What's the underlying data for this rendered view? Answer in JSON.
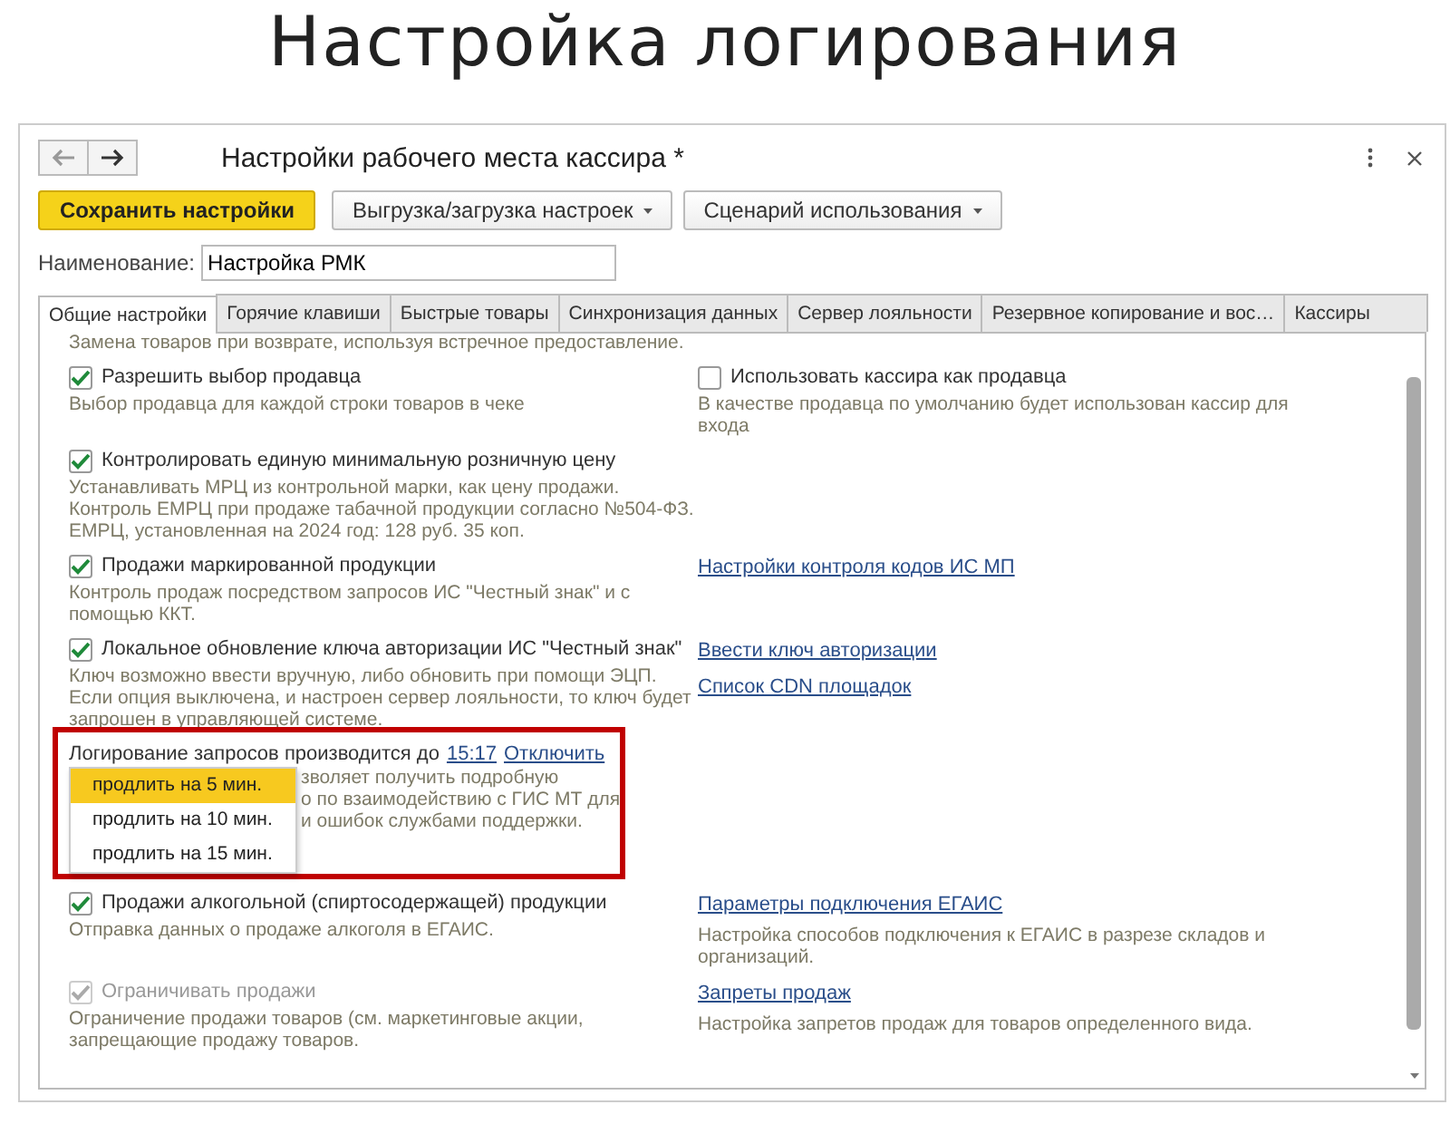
{
  "heading": "Настройка логирования",
  "window": {
    "title": "Настройки рабочего места кассира *"
  },
  "toolbar": {
    "buttons": [
      {
        "label": "Сохранить настройки",
        "kind": "primary"
      },
      {
        "label": "Выгрузка/загрузка настроек",
        "kind": "dropdown"
      },
      {
        "label": "Сценарий использования",
        "kind": "dropdown"
      }
    ]
  },
  "name_field": {
    "label": "Наименование:",
    "value": "Настройка РМК"
  },
  "tabs": [
    {
      "label": "Общие настройки",
      "selected": true
    },
    {
      "label": "Горячие клавиши",
      "selected": false
    },
    {
      "label": "Быстрые товары",
      "selected": false
    },
    {
      "label": "Синхронизация данных",
      "selected": false
    },
    {
      "label": "Сервер лояльности",
      "selected": false
    },
    {
      "label": "Резервное копирование и вос…",
      "selected": false
    },
    {
      "label": "Кассиры",
      "selected": false
    }
  ],
  "rows": [
    {
      "left": {
        "kind": "note",
        "description": "Замена товаров при возврате, используя встречное предоставление."
      },
      "right": []
    },
    {
      "left": {
        "kind": "checkbox",
        "label": "Разрешить выбор продавца",
        "checked": true,
        "disabled": false,
        "description": "Выбор продавца для каждой строки товаров в чеке"
      },
      "right": [
        {
          "kind": "checkbox",
          "label": "Использовать кассира как продавца",
          "checked": false,
          "disabled": false,
          "description": "В качестве продавца по умолчанию будет использован кассир для входа"
        }
      ]
    },
    {
      "left": {
        "kind": "checkbox",
        "label": "Контролировать единую минимальную розничную цену",
        "checked": true,
        "disabled": false,
        "description": "Устанавливать МРЦ из контрольной марки, как цену продажи. Контроль ЕМРЦ при продаже табачной продукции согласно №504-ФЗ. ЕМРЦ, установленная на 2024 год: 128 руб. 35 коп."
      },
      "right": []
    },
    {
      "left": {
        "kind": "checkbox",
        "label": "Продажи маркированной продукции",
        "checked": true,
        "disabled": false,
        "description": "Контроль продаж посредством запросов ИС \"Честный знак\" и с помощью ККТ."
      },
      "right": [
        {
          "kind": "link",
          "label": "Настройки контроля кодов ИС МП"
        }
      ]
    },
    {
      "left": {
        "kind": "checkbox",
        "label": "Локальное обновление ключа авторизации ИС \"Честный знак\"",
        "checked": true,
        "disabled": false,
        "description": "Ключ возможно ввести вручную, либо обновить при помощи ЭЦП. Если опция выключена, и настроен сервер лояльности, то ключ будет запрошен в управляющей системе."
      },
      "right": [
        {
          "kind": "link",
          "label": "Ввести ключ авторизации"
        },
        {
          "kind": "link",
          "label": "Список CDN площадок"
        }
      ]
    },
    {
      "left": {
        "kind": "logging",
        "text": "Логирование запросов производится до",
        "time": "15:17",
        "action": "Отключить",
        "description_fragments": [
          "зволяет получить подробную",
          "о по взаимодействию с ГИС МТ для",
          "и ошибок службами поддержки."
        ],
        "menu": [
          {
            "label": "продлить на 5 мин.",
            "selected": true
          },
          {
            "label": "продлить на 10 мин.",
            "selected": false
          },
          {
            "label": "продлить на 15 мин.",
            "selected": false
          }
        ]
      },
      "right": []
    },
    {
      "left": {
        "kind": "checkbox",
        "label": "Продажи алкогольной (спиртосодержащей) продукции",
        "checked": true,
        "disabled": false,
        "description": "Отправка данных о продаже алкоголя в ЕГАИС."
      },
      "right": [
        {
          "kind": "link",
          "label": "Параметры подключения ЕГАИС",
          "description": "Настройка способов подключения к ЕГАИС в разрезе складов и организаций."
        }
      ]
    },
    {
      "left": {
        "kind": "checkbox",
        "label": "Ограничивать продажи",
        "checked": true,
        "disabled": true,
        "description": "Ограничение продажи товаров (см. маркетинговые акции, запрещающие продажу товаров."
      },
      "right": [
        {
          "kind": "link",
          "label": "Запреты продаж",
          "description": "Настройка запретов продаж для товаров определенного вида."
        }
      ]
    }
  ]
}
